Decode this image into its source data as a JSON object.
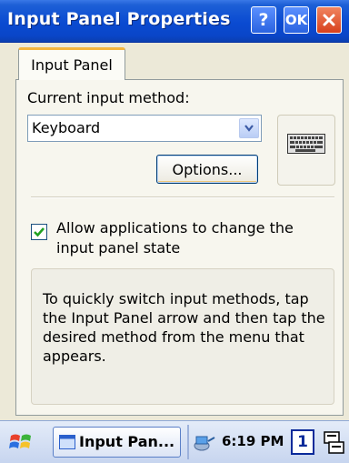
{
  "window": {
    "title": "Input Panel Properties",
    "help_label": "?",
    "ok_label": "OK"
  },
  "tabs": [
    {
      "label": "Input Panel",
      "active": true
    }
  ],
  "input_method": {
    "label": "Current input method:",
    "selected": "Keyboard",
    "options_button": "Options..."
  },
  "allow_change": {
    "checked": true,
    "label": "Allow applications to change the input panel state"
  },
  "info": {
    "text": "To quickly switch input methods, tap the Input Panel arrow and then tap the desired method from the menu that appears."
  },
  "taskbar": {
    "task_label": "Input Pan...",
    "clock": "6:19 PM",
    "input_indicator": "1"
  },
  "colors": {
    "titlebar": "#0a4ad1",
    "dialog_background": "#ece9d8",
    "check": "#21a121"
  }
}
